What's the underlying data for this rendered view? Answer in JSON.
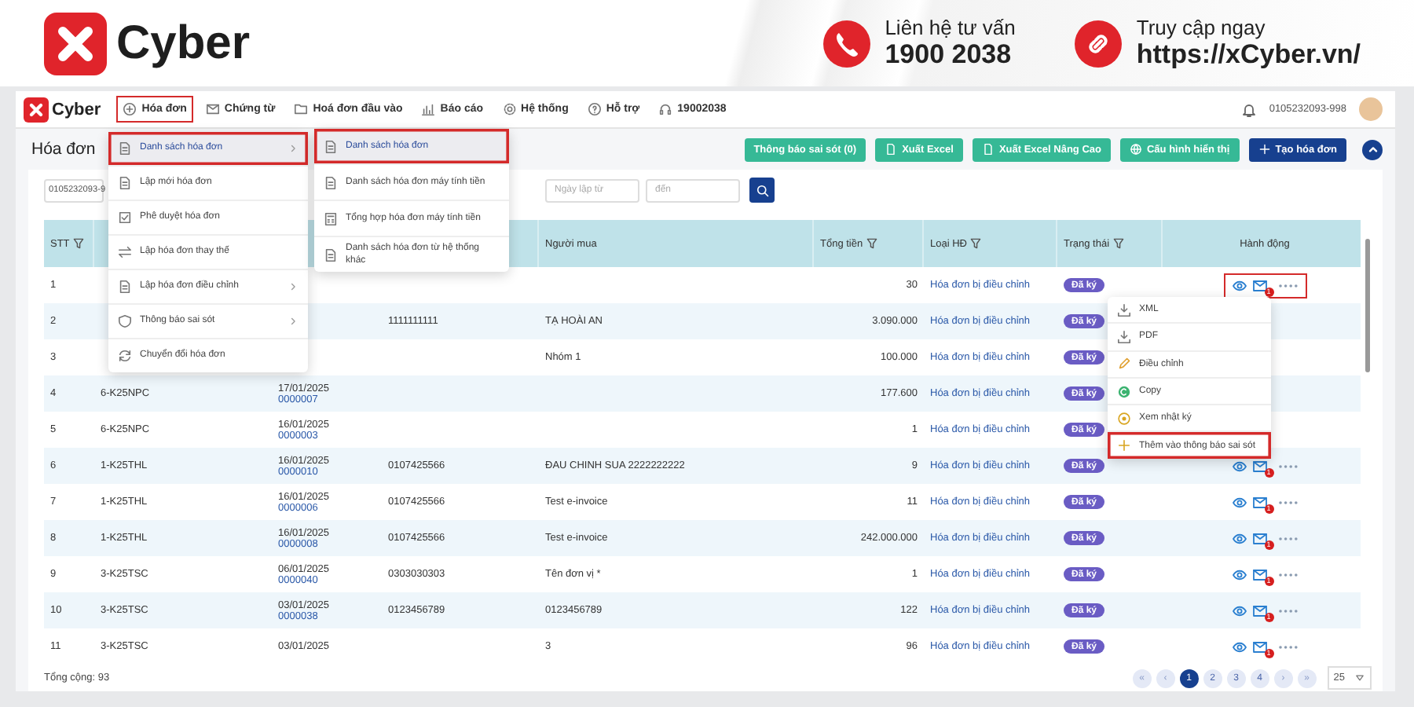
{
  "banner": {
    "brand": "Cyber",
    "contacts": [
      {
        "kind": "phone",
        "label": "Liên hệ tư vấn",
        "value": "1900 2038"
      },
      {
        "kind": "link",
        "label": "Truy cập ngay",
        "value": "https://xCyber.vn/"
      }
    ]
  },
  "nav": {
    "brand": "Cyber",
    "items": [
      {
        "label": "Hóa đơn",
        "highlighted": true
      },
      {
        "label": "Chứng từ",
        "highlighted": false
      },
      {
        "label": "Hoá đơn đầu vào",
        "highlighted": false
      },
      {
        "label": "Báo cáo",
        "highlighted": false
      },
      {
        "label": "Hệ thống",
        "highlighted": false
      },
      {
        "label": "Hỗ trợ",
        "highlighted": false
      },
      {
        "label": "19002038",
        "highlighted": false
      }
    ],
    "account": "0105232093-998"
  },
  "page": {
    "title": "Hóa đơn",
    "buttons": [
      {
        "label": "Thông báo sai sót (0)",
        "kind": "secondary"
      },
      {
        "label": "Xuất Excel",
        "kind": "secondary"
      },
      {
        "label": "Xuất Excel Nâng Cao",
        "kind": "secondary"
      },
      {
        "label": "Cấu hình hiển thị",
        "kind": "secondary"
      },
      {
        "label": "Tạo hóa đơn",
        "kind": "primary"
      }
    ]
  },
  "filters": [
    {
      "value": "0105232093-9"
    },
    {
      "placeholder": "Ngày lập từ"
    },
    {
      "placeholder": "đến"
    }
  ],
  "table": {
    "columns": [
      {
        "label": "STT",
        "filter": true
      },
      {
        "label": "Người mua"
      },
      {
        "label": "Tổng tiền",
        "filter": true
      },
      {
        "label": "Loại HĐ",
        "filter": true
      },
      {
        "label": "Trạng thái",
        "filter": true
      },
      {
        "label": "Hành động"
      }
    ],
    "rows": [
      {
        "stt": "1",
        "total": "30",
        "type": "Hóa đơn bị điều chỉnh",
        "status": "Đã ký",
        "mail_count": "1",
        "highlighted": true
      },
      {
        "stt": "2",
        "tax_id": "1111111111",
        "buyer": "TẠ HOÀI AN",
        "total": "3.090.000",
        "type": "Hóa đơn bị điều chỉnh",
        "status": "Đã ký"
      },
      {
        "stt": "3",
        "buyer": "Nhóm 1",
        "total": "100.000",
        "type": "Hóa đơn bị điều chỉnh",
        "status": "Đã ký"
      },
      {
        "stt": "4",
        "symbol": "6-K25NPC",
        "date": "17/01/2025",
        "number": "0000007",
        "total": "177.600",
        "type": "Hóa đơn bị điều chỉnh",
        "status": "Đã ký"
      },
      {
        "stt": "5",
        "symbol": "6-K25NPC",
        "date": "16/01/2025",
        "number": "0000003",
        "total": "1",
        "type": "Hóa đơn bị điều chỉnh",
        "status": "Đã ký"
      },
      {
        "stt": "6",
        "symbol": "1-K25THL",
        "date": "16/01/2025",
        "number": "0000010",
        "tax_id": "0107425566",
        "buyer": "ĐAU CHINH SUA 2222222222",
        "total": "9",
        "type": "Hóa đơn bị điều chỉnh",
        "status": "Đã ký",
        "mail_count": "1",
        "highlighted": false
      },
      {
        "stt": "7",
        "symbol": "1-K25THL",
        "date": "16/01/2025",
        "number": "0000006",
        "tax_id": "0107425566",
        "buyer": "Test e-invoice",
        "total": "11",
        "type": "Hóa đơn bị điều chỉnh",
        "status": "Đã ký",
        "mail_count": "1",
        "highlighted": false
      },
      {
        "stt": "8",
        "symbol": "1-K25THL",
        "date": "16/01/2025",
        "number": "0000008",
        "tax_id": "0107425566",
        "buyer": "Test e-invoice",
        "total": "242.000.000",
        "type": "Hóa đơn bị điều chỉnh",
        "status": "Đã ký",
        "mail_count": "1",
        "highlighted": false
      },
      {
        "stt": "9",
        "symbol": "3-K25TSC",
        "date": "06/01/2025",
        "number": "0000040",
        "tax_id": "0303030303",
        "buyer": "Tên đơn vị *",
        "total": "1",
        "type": "Hóa đơn bị điều chỉnh",
        "status": "Đã ký",
        "mail_count": "1",
        "highlighted": false
      },
      {
        "stt": "10",
        "symbol": "3-K25TSC",
        "date": "03/01/2025",
        "number": "0000038",
        "tax_id": "0123456789",
        "buyer": "0123456789",
        "total": "122",
        "type": "Hóa đơn bị điều chỉnh",
        "status": "Đã ký",
        "mail_count": "1",
        "highlighted": false
      },
      {
        "stt": "11",
        "symbol": "3-K25TSC",
        "date": "03/01/2025",
        "buyer": "3",
        "total": "96",
        "type": "Hóa đơn bị điều chỉnh",
        "status": "Đã ký",
        "mail_count": "1",
        "highlighted": false
      }
    ]
  },
  "menu": {
    "items": [
      {
        "label": "Danh sách hóa đơn",
        "submenu": true,
        "selected": true,
        "highlighted": true
      },
      {
        "label": "Lập mới hóa đơn",
        "submenu": false,
        "selected": false,
        "highlighted": false
      },
      {
        "label": "Phê duyệt hóa đơn",
        "submenu": false,
        "selected": false,
        "highlighted": false
      },
      {
        "label": "Lập hóa đơn thay thế",
        "submenu": false,
        "selected": false,
        "highlighted": false
      },
      {
        "label": "Lập hóa đơn điều chỉnh",
        "submenu": true,
        "selected": false,
        "highlighted": false
      },
      {
        "label": "Thông báo sai sót",
        "submenu": true,
        "selected": false,
        "highlighted": false
      },
      {
        "label": "Chuyển đổi hóa đơn",
        "submenu": false,
        "selected": false,
        "highlighted": false
      }
    ]
  },
  "submenu": {
    "items": [
      {
        "label": "Danh sách hóa đơn",
        "submenu": false,
        "selected": true,
        "highlighted": true
      },
      {
        "label": "Danh sách hóa đơn máy tính tiền",
        "submenu": false,
        "selected": false,
        "highlighted": false
      },
      {
        "label": "Tổng hợp hóa đơn máy tính tiền",
        "submenu": false,
        "selected": false,
        "highlighted": false
      },
      {
        "label": "Danh sách hóa đơn từ hệ thống khác",
        "submenu": false,
        "selected": false,
        "highlighted": false
      }
    ]
  },
  "row_menu": {
    "items": [
      {
        "label": "XML",
        "submenu": false,
        "selected": false,
        "highlighted": false
      },
      {
        "label": "PDF",
        "submenu": false,
        "selected": false,
        "highlighted": false
      },
      {
        "label": "Điều chỉnh",
        "submenu": false,
        "selected": false,
        "highlighted": false
      },
      {
        "label": "Copy",
        "submenu": false,
        "selected": false,
        "highlighted": false
      },
      {
        "label": "Xem nhật ký",
        "submenu": false,
        "selected": false,
        "highlighted": false
      },
      {
        "label": "Thêm vào thông báo sai sót",
        "submenu": false,
        "selected": false,
        "highlighted": true
      }
    ]
  },
  "footer": {
    "total": "Tổng cộng: 93",
    "page_size": "25",
    "pages": [
      {
        "label": "«",
        "kind": "nav",
        "selected": false
      },
      {
        "label": "‹",
        "kind": "nav",
        "selected": false
      },
      {
        "label": "1",
        "kind": "page",
        "selected": true
      },
      {
        "label": "2",
        "kind": "page",
        "selected": false
      },
      {
        "label": "3",
        "kind": "page",
        "selected": false
      },
      {
        "label": "4",
        "kind": "page",
        "selected": false
      },
      {
        "label": "›",
        "kind": "nav",
        "selected": false
      },
      {
        "label": "»",
        "kind": "nav",
        "selected": false
      }
    ]
  }
}
